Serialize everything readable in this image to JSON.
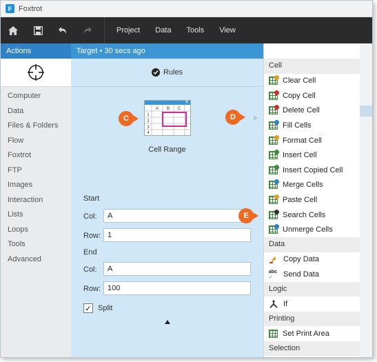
{
  "window": {
    "title": "Foxtrot",
    "logo": "F"
  },
  "toolbar": {
    "icons": [
      "home-icon",
      "save-icon",
      "undo-icon",
      "redo-icon"
    ],
    "menus": [
      "Project",
      "Data",
      "Tools",
      "View"
    ]
  },
  "actions_panel": {
    "header": "Actions",
    "target_icon": "crosshair-icon",
    "items": [
      "Computer",
      "Data",
      "Files & Folders",
      "Flow",
      "Foxtrot",
      "FTP",
      "Images",
      "Interaction",
      "Lists",
      "Loops",
      "Tools",
      "Advanced"
    ]
  },
  "target_panel": {
    "header": "Target • 30 secs ago",
    "rules_label": "Rules",
    "cell_range_label": "Cell Range",
    "cell_grid": {
      "cols": [
        "A",
        "B",
        "C"
      ],
      "rows": [
        "1",
        "2",
        "3",
        "4"
      ]
    },
    "callouts": {
      "c": "C",
      "d": "D",
      "e": "E"
    },
    "start": {
      "heading": "Start",
      "col_label": "Col:",
      "col_value": "A",
      "row_label": "Row:",
      "row_value": "1"
    },
    "end": {
      "heading": "End",
      "col_label": "Col:",
      "col_value": "A",
      "row_label": "Row:",
      "row_value": "100"
    },
    "split": {
      "label": "Split",
      "checked": true
    }
  },
  "cell_panel": {
    "close_glyph": "✕",
    "groups": [
      {
        "name": "Cell",
        "items": [
          "Clear Cell",
          "Copy Cell",
          "Delete Cell",
          "Fill Cells",
          "Format Cell",
          "Insert Cell",
          "Insert Copied Cell",
          "Merge Cells",
          "Paste Cell",
          "Search Cells",
          "Unmerge Cells"
        ]
      },
      {
        "name": "Data",
        "items": [
          "Copy Data",
          "Send Data"
        ]
      },
      {
        "name": "Logic",
        "items": [
          "If"
        ]
      },
      {
        "name": "Printing",
        "items": [
          "Set Print Area"
        ]
      },
      {
        "name": "Selection",
        "items": []
      }
    ]
  },
  "colors": {
    "accent": "#3b94d4",
    "callout": "#ee6a22",
    "panel_bg": "#cfe7f6",
    "toolbar_bg": "#2b2b2b"
  }
}
